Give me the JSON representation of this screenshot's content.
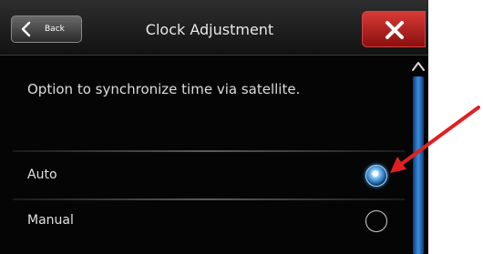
{
  "header": {
    "back_label": "Back",
    "title": "Clock Adjustment"
  },
  "description": "Option to synchronize time via satellite.",
  "options": [
    {
      "label": "Auto",
      "selected": true
    },
    {
      "label": "Manual",
      "selected": false
    }
  ],
  "colors": {
    "close_button": "#c62828",
    "scrollbar": "#2a7fd4",
    "annotation_arrow": "#e02020"
  },
  "icons": {
    "back": "chevron-left-icon",
    "close": "close-icon",
    "scroll_up": "chevron-up-icon"
  }
}
